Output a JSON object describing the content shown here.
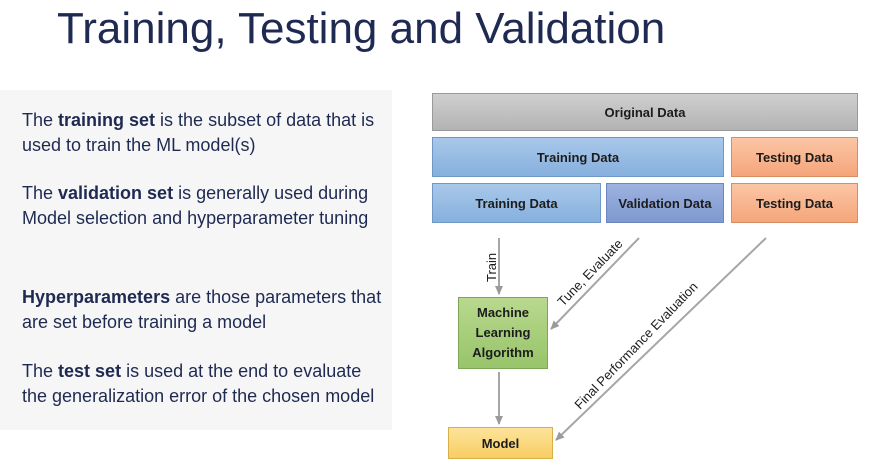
{
  "title": "Training, Testing and Validation",
  "paragraphs": [
    {
      "bold": "training set",
      "before": "The ",
      "after": " is the subset of data that is used to train the ML model(s)"
    },
    {
      "bold": "validation set",
      "before": "The ",
      "after": " is generally used during Model selection and hyperparameter tuning"
    },
    {
      "bold": "Hyperparameters",
      "before": "",
      "after": " are those parameters that are set before training a model"
    },
    {
      "bold": "test set",
      "before": "The ",
      "after": " is used at the end to evaluate the generalization error of the chosen model"
    }
  ],
  "diagram": {
    "original": "Original Data",
    "row2_training": "Training Data",
    "row2_testing": "Testing Data",
    "row3_training": "Training Data",
    "row3_validation": "Validation Data",
    "row3_testing": "Testing Data",
    "algorithm": "Machine Learning Algorithm",
    "model": "Model",
    "edge_train": "Train",
    "edge_tune": "Tune, Evaluate",
    "edge_final": "Final Performance Evaluation"
  }
}
